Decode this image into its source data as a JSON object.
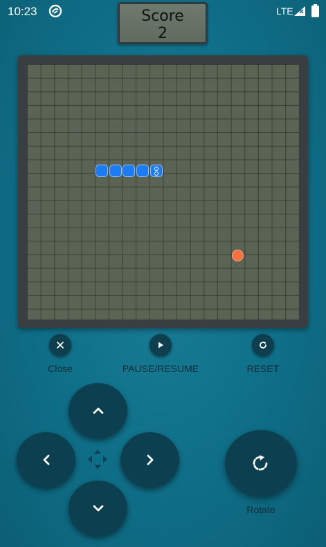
{
  "status_bar": {
    "time": "10:23",
    "network": "LTE"
  },
  "score": {
    "label": "Score",
    "value": "2"
  },
  "game": {
    "grid_cols": 20,
    "grid_rows": 18,
    "snake": [
      {
        "col": 5,
        "row": 7
      },
      {
        "col": 6,
        "row": 7
      },
      {
        "col": 7,
        "row": 7
      },
      {
        "col": 8,
        "row": 7
      },
      {
        "col": 9,
        "row": 7
      }
    ],
    "food": {
      "col": 15,
      "row": 13
    },
    "colors": {
      "board": "#5b6355",
      "snake": "#1c7cf3",
      "food": "#f4703e"
    }
  },
  "controls": {
    "close_label": "Close",
    "pause_label": "PAUSE/RESUME",
    "reset_label": "RESET",
    "rotate_label": "Rotate",
    "icons": {
      "close": "close-icon",
      "pause": "play-icon",
      "reset": "refresh-icon",
      "up": "chevron-up-icon",
      "down": "chevron-down-icon",
      "left": "chevron-left-icon",
      "right": "chevron-right-icon",
      "rotate": "rotate-icon"
    }
  }
}
